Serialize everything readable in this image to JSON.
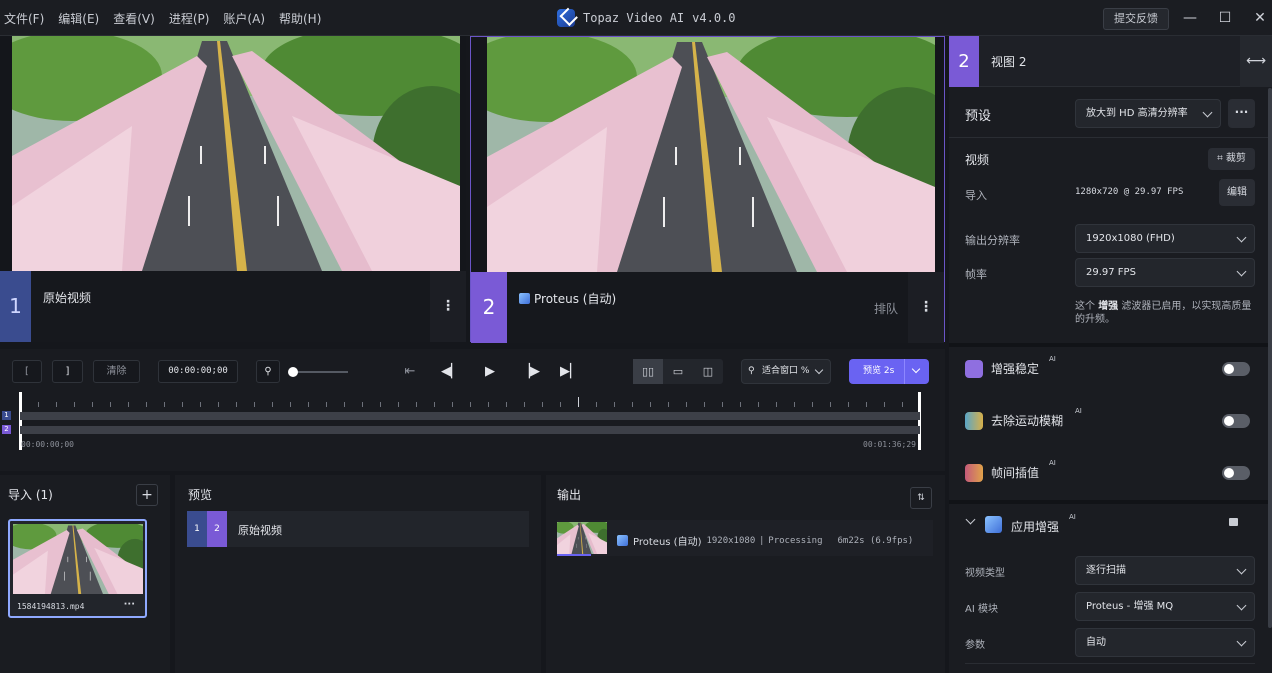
{
  "menu": [
    "文件(F)",
    "编辑(E)",
    "查看(V)",
    "进程(P)",
    "账户(A)",
    "帮助(H)"
  ],
  "app": {
    "name": "Topaz Video AI",
    "version": "v4.0.0"
  },
  "titlebar": {
    "feedback_label": "提交反馈",
    "minimize": "—",
    "maximize": "☐",
    "close": "✕"
  },
  "pane1": {
    "number": "1",
    "label": "原始视频"
  },
  "pane2": {
    "number": "2",
    "label": "Proteus (自动)",
    "status": "排队"
  },
  "right_panel": {
    "view_number": "2",
    "view_title": "视图 2",
    "preset_label": "预设",
    "preset_value": "放大到 HD 高清分辨率",
    "video_heading": "视频",
    "crop_label": "裁剪",
    "import_label": "导入",
    "import_value": "1280x720 @ 29.97 FPS",
    "edit_label": "编辑",
    "output_res_label": "输出分辨率",
    "output_res_value": "1920x1080 (FHD)",
    "framerate_label": "帧率",
    "framerate_value": "29.97 FPS",
    "enhance_note_prefix": "这个",
    "enhance_note_bold": "增强",
    "enhance_note_suffix": "滤波器已启用，以实现高质量的升频。",
    "features": [
      {
        "label": "增强稳定",
        "ai": "AI",
        "enabled": false,
        "color": "#8f6fe0"
      },
      {
        "label": "去除运动模糊",
        "ai": "AI",
        "enabled": false,
        "color": "#5aa6c7"
      },
      {
        "label": "帧间插值",
        "ai": "AI",
        "enabled": false,
        "color": "#c45a7a"
      }
    ],
    "apply_enhance_label": "应用增强",
    "apply_enhance_ai": "AI",
    "video_type_label": "视频类型",
    "video_type_value": "逐行扫描",
    "ai_model_label": "AI 模块",
    "ai_model_value": "Proteus - 增强 MQ",
    "params_label": "参数",
    "params_value": "自动"
  },
  "transport": {
    "mark_in": "[",
    "mark_out": "]",
    "clear_label": "清除",
    "timecode": "00:00:00;00",
    "fit_label": "适合窗口 %",
    "preview_label": "预览 2s",
    "zoom_level": 0.0
  },
  "timeline": {
    "start": "00:00:00;00",
    "end": "00:01:36;29",
    "track1_tag": "1",
    "track2_tag": "2"
  },
  "import_panel": {
    "title": "导入 (1)",
    "add": "+",
    "file_name": "1584194813.mp4",
    "more": "···"
  },
  "preview_panel": {
    "title": "预览",
    "row_tag1": "1",
    "row_tag2": "2",
    "row_label": "原始视频"
  },
  "output_panel": {
    "title": "输出",
    "sort": "⇅",
    "model": "Proteus (自动)",
    "resolution": "1920x1080",
    "status": "Processing",
    "eta": "6m22s (6.9fps)",
    "progress": 0.09
  }
}
